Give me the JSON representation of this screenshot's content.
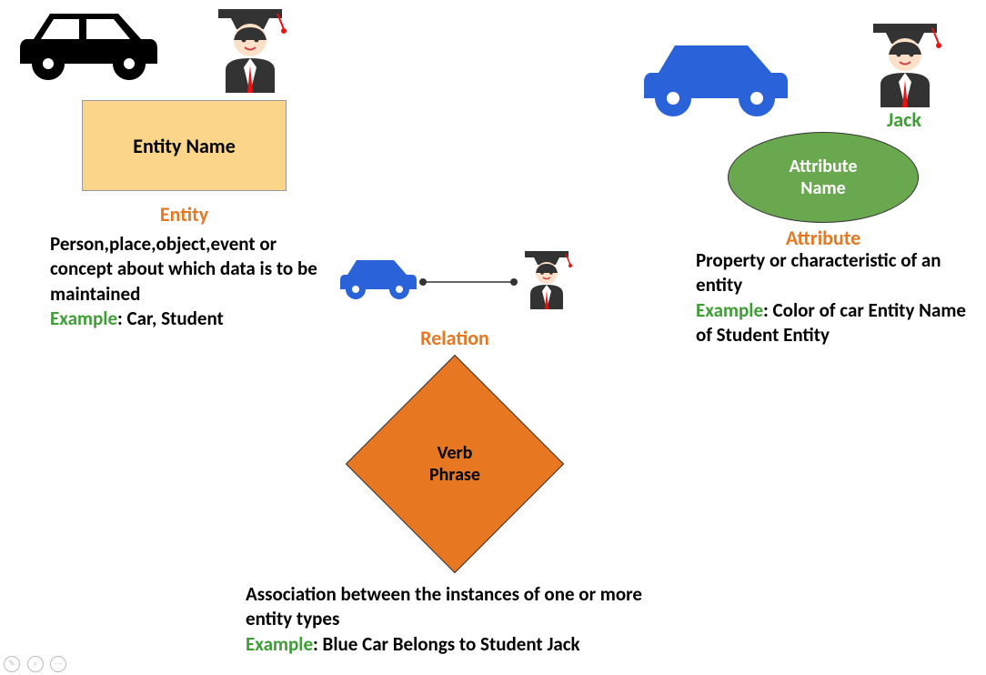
{
  "entity": {
    "shape_label": "Entity Name",
    "title": "Entity",
    "description": "Person,place,object,event or concept about which data is to be maintained",
    "example_label": "Example",
    "example_text": ": Car, Student"
  },
  "relation": {
    "shape_label_1": "Verb",
    "shape_label_2": "Phrase",
    "title": "Relation",
    "description": "Association between the instances of one or more entity types",
    "example_label": "Example",
    "example_text": ": Blue Car Belongs to Student Jack"
  },
  "attribute": {
    "shape_label_1": "Attribute",
    "shape_label_2": "Name",
    "title": "Attribute",
    "jack": "Jack",
    "description": "Property or characteristic of an entity",
    "example_label": "Example",
    "example_text": ": Color of car Entity Name of Student Entity"
  },
  "icons": {
    "car_black": "car-icon",
    "car_blue": "car-icon",
    "graduate": "graduate-icon"
  }
}
